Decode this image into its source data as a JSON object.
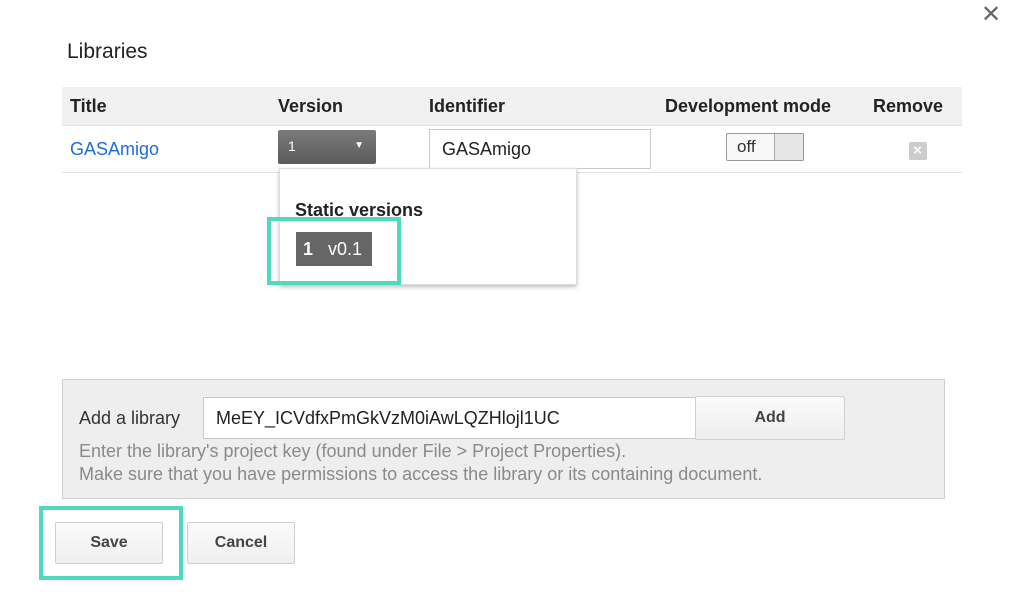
{
  "dialog": {
    "title": "Libraries",
    "close_icon": "close-icon"
  },
  "table": {
    "headers": {
      "title": "Title",
      "version": "Version",
      "identifier": "Identifier",
      "dev_mode": "Development mode",
      "remove": "Remove"
    },
    "rows": [
      {
        "title": "GASAmigo",
        "version": "1",
        "identifier": "GASAmigo",
        "dev_mode": "off",
        "remove_icon": "remove-icon"
      }
    ]
  },
  "version_dropdown": {
    "heading": "Static versions",
    "items": [
      {
        "number": "1",
        "label": "v0.1"
      }
    ]
  },
  "add_library": {
    "label": "Add a library",
    "value": "MeEY_ICVdfxPmGkVzM0iAwLQZHlojl1UC",
    "button": "Add",
    "hint_line1": "Enter the library's project key (found under File > Project Properties).",
    "hint_line2": "Make sure that you have permissions to access the library or its containing document."
  },
  "footer": {
    "save": "Save",
    "cancel": "Cancel"
  },
  "colors": {
    "highlight": "#4fd9bf",
    "link": "#1a6fe0",
    "version_button": "#666666"
  }
}
